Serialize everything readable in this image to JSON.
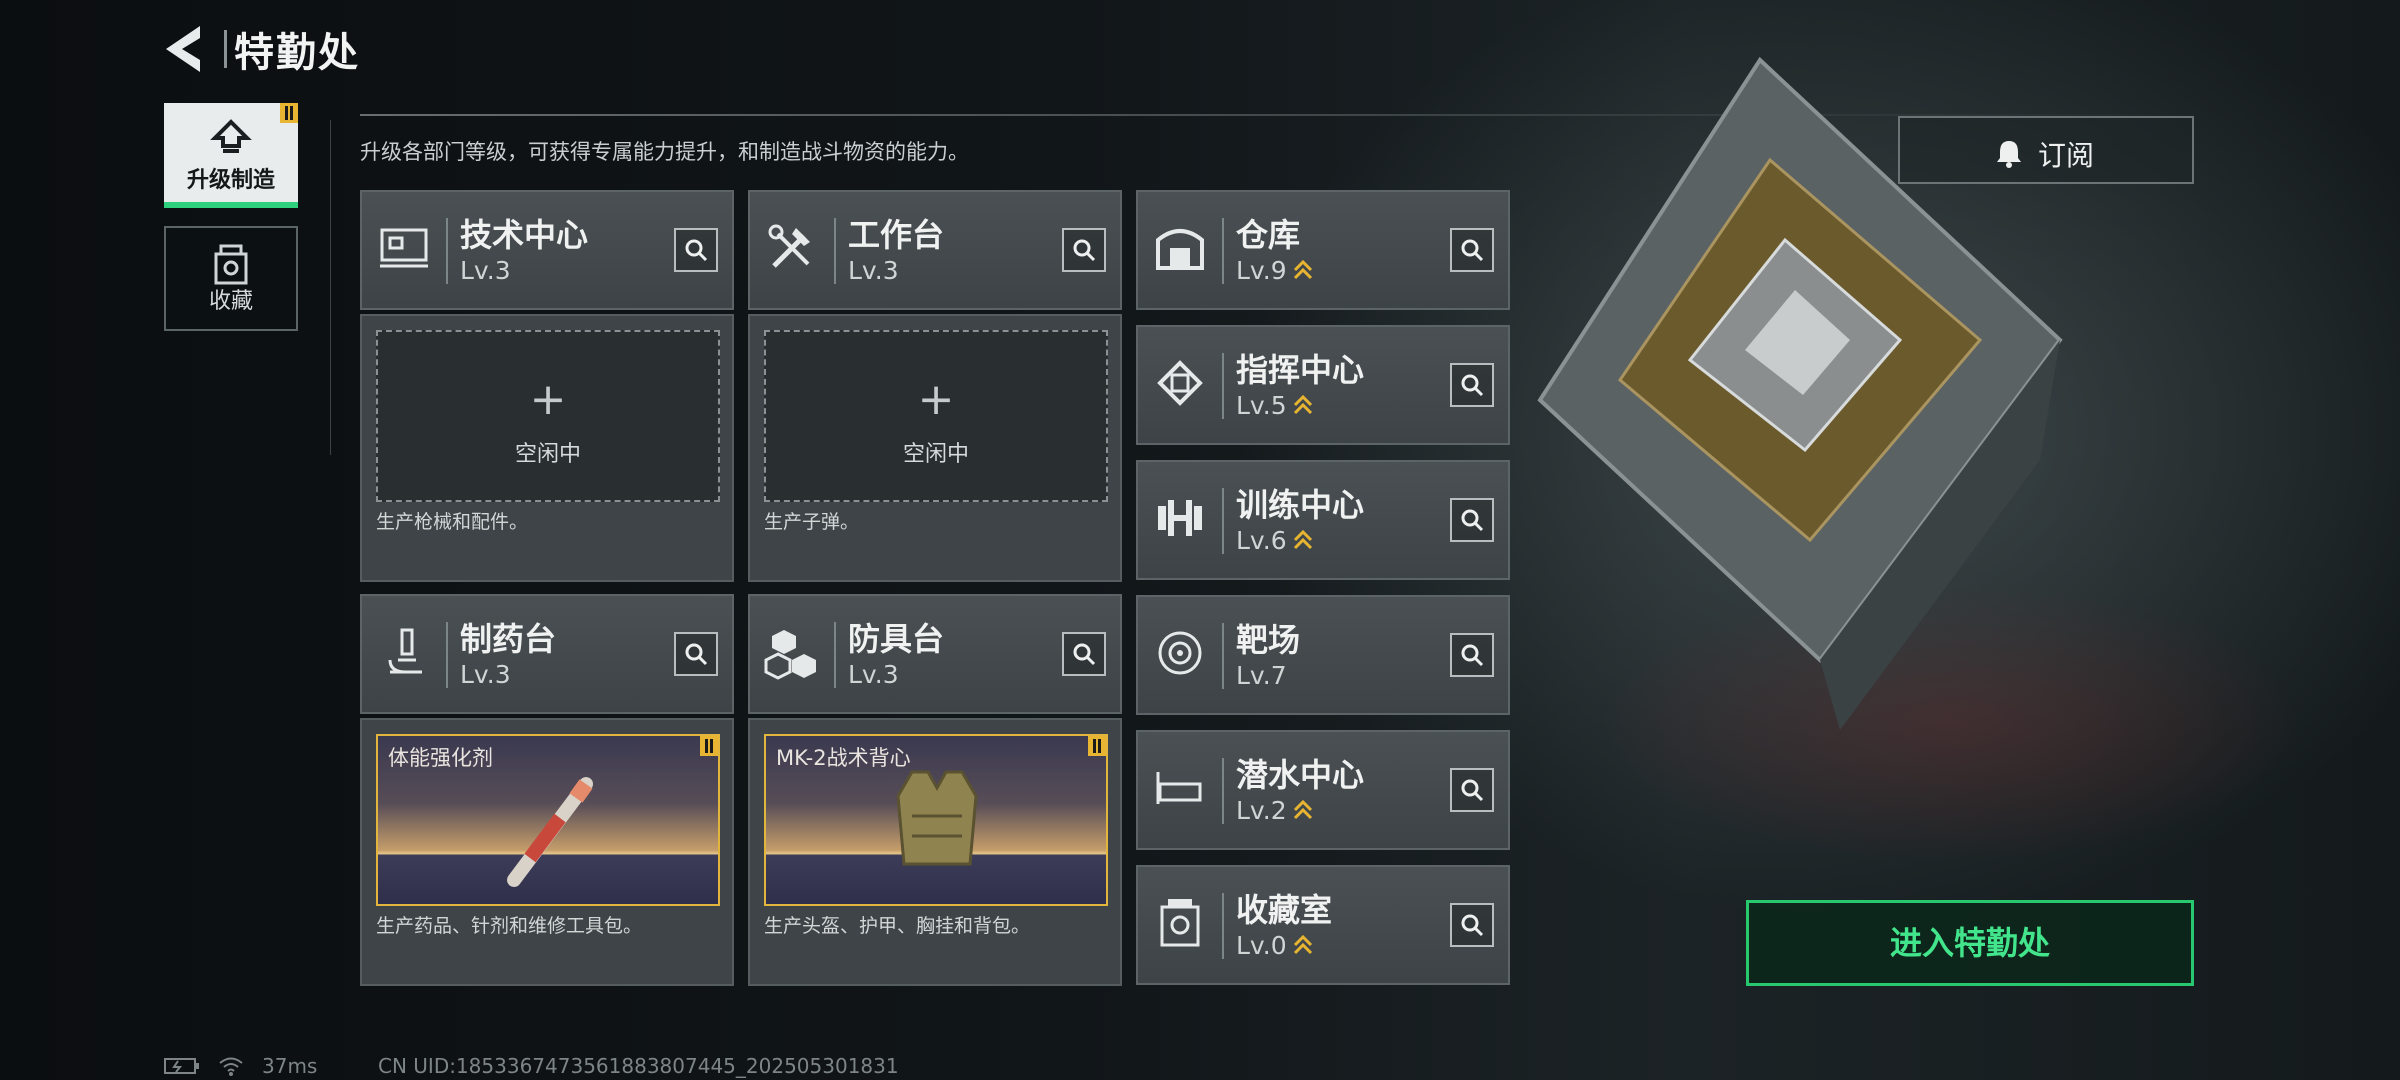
{
  "header": {
    "title": "特勤处"
  },
  "nav": {
    "upgrade_label": "升级制造",
    "collect_label": "收藏"
  },
  "description": "升级各部门等级，可获得专属能力提升，和制造战斗物资的能力。",
  "cards": {
    "tech": {
      "name": "技术中心",
      "level": "Lv.3",
      "slot": "空闲中",
      "note": "生产枪械和配件。"
    },
    "bench": {
      "name": "工作台",
      "level": "Lv.3",
      "slot": "空闲中",
      "note": "生产子弹。"
    },
    "pharma": {
      "name": "制药台",
      "level": "Lv.3",
      "product": "体能强化剂",
      "note": "生产药品、针剂和维修工具包。"
    },
    "armor": {
      "name": "防具台",
      "level": "Lv.3",
      "product": "MK-2战术背心",
      "note": "生产头盔、护甲、胸挂和背包。"
    }
  },
  "side_cards": {
    "warehouse": {
      "name": "仓库",
      "level": "Lv.9"
    },
    "command": {
      "name": "指挥中心",
      "level": "Lv.5"
    },
    "training": {
      "name": "训练中心",
      "level": "Lv.6"
    },
    "range": {
      "name": "靶场",
      "level": "Lv.7"
    },
    "diving": {
      "name": "潜水中心",
      "level": "Lv.2"
    },
    "collection": {
      "name": "收藏室",
      "level": "Lv.0"
    }
  },
  "subscribe_label": "订阅",
  "enter_label": "进入特勤处",
  "status": {
    "ping": "37ms",
    "uid": "CN UID:1853367473561883807445_202505301831"
  },
  "colors": {
    "accent_green": "#2fd07d",
    "upgrade_gold": "#e7b531",
    "panel": "#3e4447"
  },
  "icons": [
    "back-arrow-icon",
    "upgrade-icon",
    "collect-icon",
    "search-icon",
    "bell-icon",
    "upgrade-chevron-icon",
    "battery-icon",
    "wifi-icon"
  ]
}
